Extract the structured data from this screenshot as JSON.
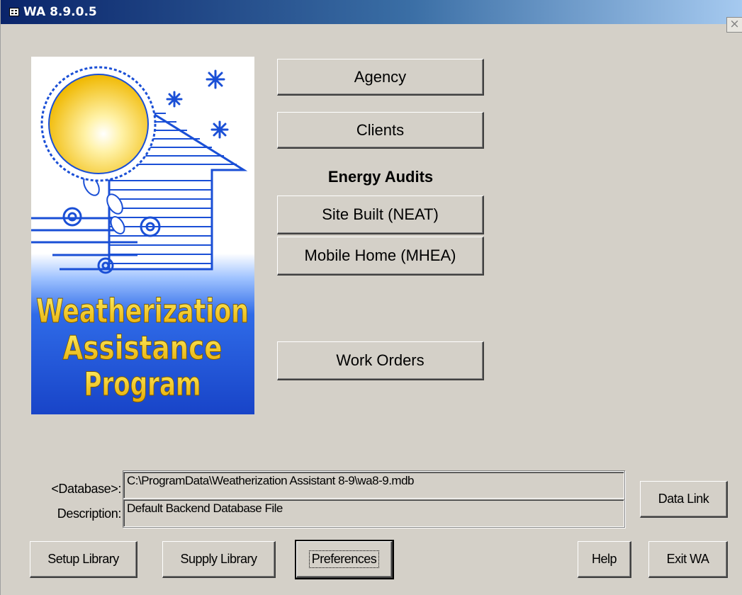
{
  "window": {
    "title": "WA 8.9.0.5",
    "close_symbol": "×",
    "icon": "form-icon"
  },
  "logo": {
    "line1": "Weatherization",
    "line2": "Assistance",
    "line3": "Program",
    "icons": [
      "sun-icon",
      "snowflake-icon",
      "house-icon",
      "wind-icon",
      "leaf-icon"
    ]
  },
  "main": {
    "agency_label": "Agency",
    "clients_label": "Clients",
    "audits_heading": "Energy Audits",
    "site_built_label": "Site Built (NEAT)",
    "mobile_home_label": "Mobile Home (MHEA)",
    "work_orders_label": "Work Orders"
  },
  "database": {
    "db_label": "<Database>:",
    "db_value": "C:\\ProgramData\\Weatherization Assistant 8-9\\wa8-9.mdb",
    "desc_label": "Description:",
    "desc_value": "Default Backend Database File",
    "data_link_label": "Data Link"
  },
  "footer": {
    "setup_library_label": "Setup Library",
    "supply_library_label": "Supply Library",
    "preferences_label": "Preferences",
    "help_label": "Help",
    "exit_label": "Exit WA"
  },
  "colors": {
    "face": "#d4d0c8",
    "title_start": "#0a246a",
    "title_end": "#a6caf0",
    "logo_blue": "#1a4fd6",
    "logo_yellow": "#f5d020"
  }
}
